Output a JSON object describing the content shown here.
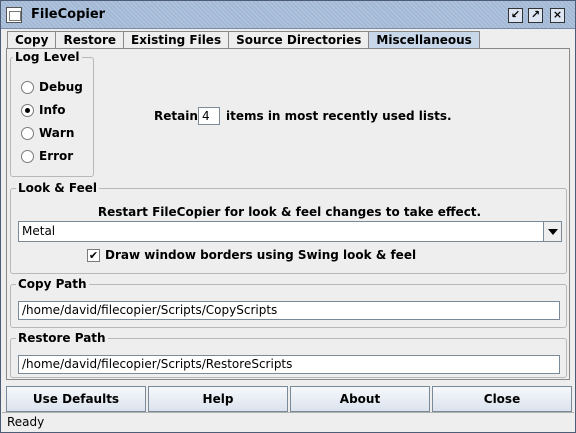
{
  "window": {
    "title": "FileCopier"
  },
  "tabs": [
    {
      "label": "Copy"
    },
    {
      "label": "Restore"
    },
    {
      "label": "Existing Files"
    },
    {
      "label": "Source Directories"
    },
    {
      "label": "Miscellaneous"
    }
  ],
  "log_level": {
    "title": "Log Level",
    "options": [
      {
        "label": "Debug",
        "checked": false
      },
      {
        "label": "Info",
        "checked": true
      },
      {
        "label": "Warn",
        "checked": false
      },
      {
        "label": "Error",
        "checked": false
      }
    ]
  },
  "retain": {
    "prefix": "Retain",
    "value": "4",
    "suffix": "items in most recently used lists."
  },
  "look_feel": {
    "title": "Look & Feel",
    "note": "Restart FileCopier for look & feel changes to take effect.",
    "selected": "Metal",
    "checkbox_label": "Draw window borders using Swing look & feel",
    "checkbox_checked": true
  },
  "copy_path": {
    "title": "Copy Path",
    "value": "/home/david/filecopier/Scripts/CopyScripts"
  },
  "restore_path": {
    "title": "Restore Path",
    "value": "/home/david/filecopier/Scripts/RestoreScripts"
  },
  "buttons": {
    "use_defaults": "Use Defaults",
    "help": "Help",
    "about": "About",
    "close": "Close"
  },
  "status": "Ready"
}
